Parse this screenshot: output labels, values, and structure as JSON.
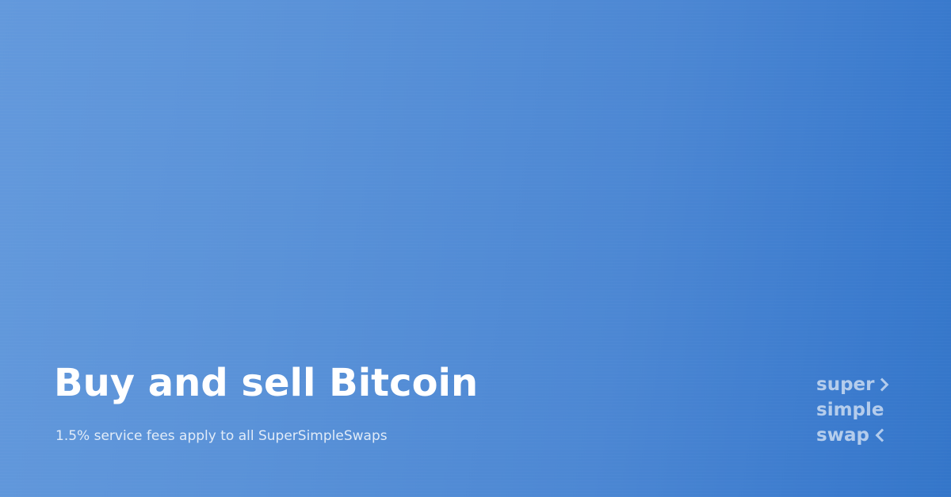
{
  "banner": {
    "headline": "Buy and sell Bitcoin",
    "subline": "1.5% service fees apply to all SuperSimpleSwaps"
  },
  "logo": {
    "line1": "super",
    "line2": "simple",
    "line3": "swap",
    "icon_right": "chevron-right-icon",
    "icon_left": "chevron-left-icon"
  },
  "colors": {
    "background_start": "#6399dc",
    "background_end": "#3476c9",
    "text": "#ffffff"
  }
}
